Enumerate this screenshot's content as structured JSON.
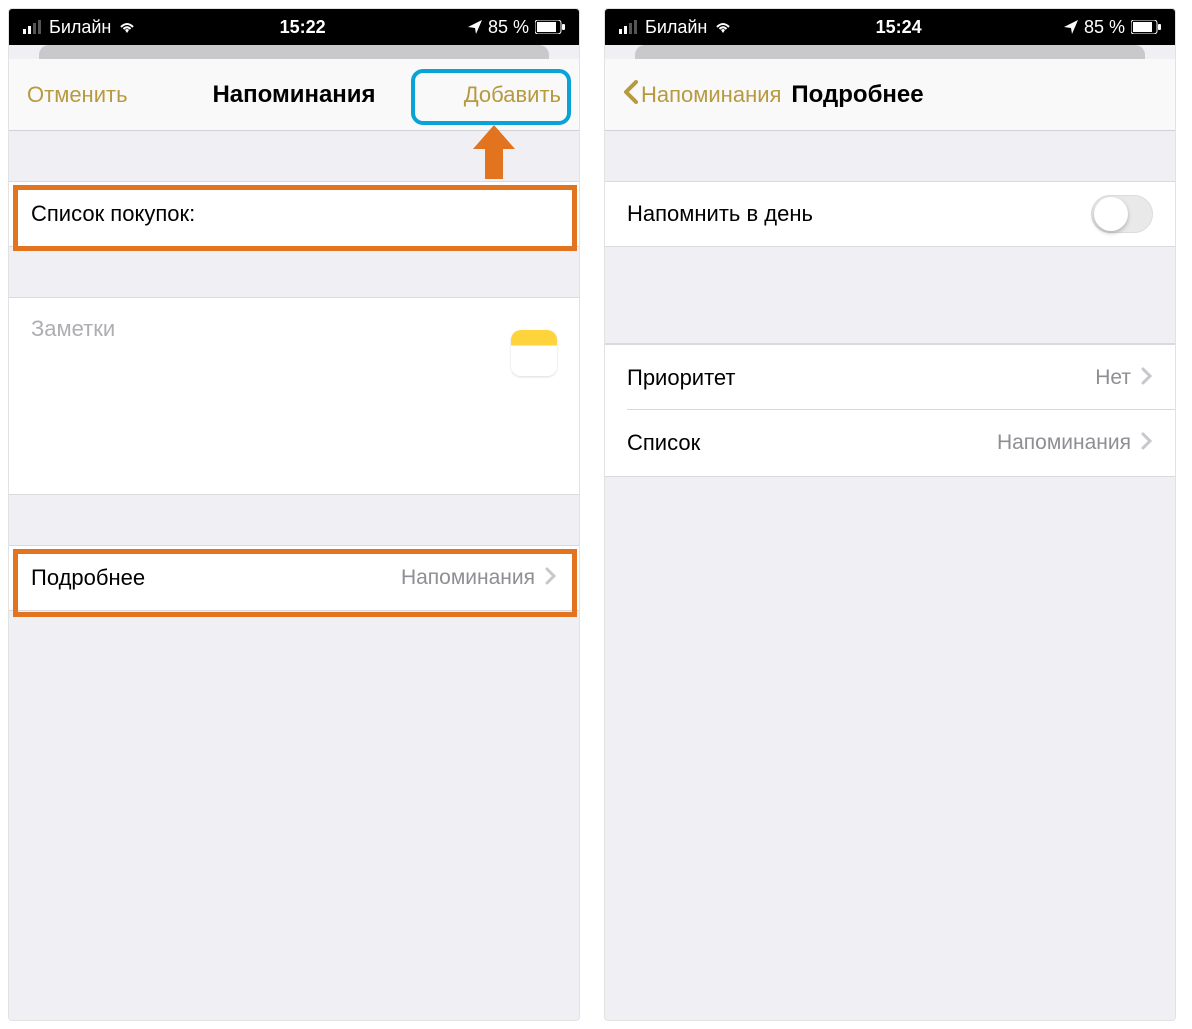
{
  "left": {
    "statusbar": {
      "carrier": "Билайн",
      "time": "15:22",
      "battery_text": "85 %"
    },
    "nav": {
      "cancel": "Отменить",
      "title": "Напоминания",
      "add": "Добавить"
    },
    "title_input_value": "Список покупок:",
    "notes_placeholder": "Заметки",
    "details_row": {
      "label": "Подробнее",
      "value": "Напоминания"
    }
  },
  "right": {
    "statusbar": {
      "carrier": "Билайн",
      "time": "15:24",
      "battery_text": "85 %"
    },
    "nav": {
      "back": "Напоминания",
      "title": "Подробнее"
    },
    "remind_day_label": "Напомнить в день",
    "priority_row": {
      "label": "Приоритет",
      "value": "Нет"
    },
    "list_row": {
      "label": "Список",
      "value": "Напоминания"
    }
  },
  "colors": {
    "accent": "#b79a3f",
    "highlight_orange": "#e2731f",
    "highlight_blue": "#0aa3d8"
  }
}
